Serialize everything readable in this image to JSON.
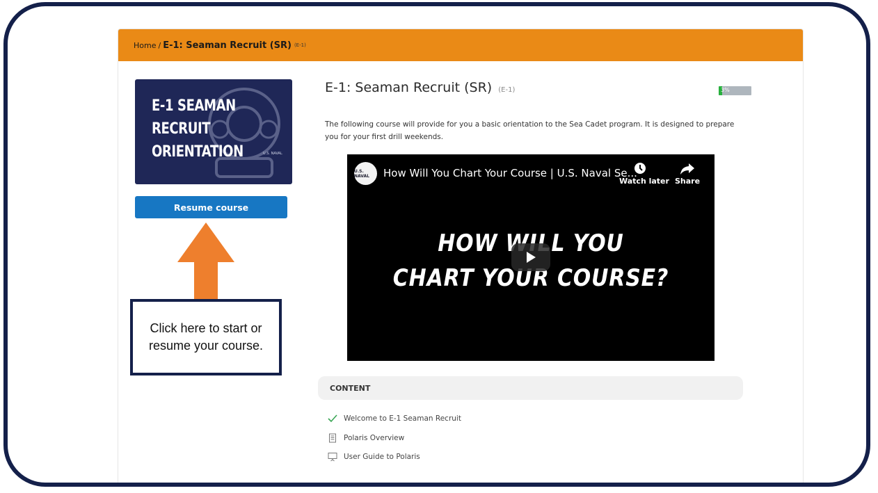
{
  "breadcrumb": {
    "home": "Home",
    "separator": "/",
    "current": "E-1: Seaman Recruit (SR)",
    "code": "(E-1)"
  },
  "course": {
    "thumbnail_text": [
      "E-1 SEAMAN",
      "RECRUIT",
      "ORIENTATION"
    ],
    "thumbnail_logo_text": "U.S. NAVAL",
    "title": "E-1: Seaman Recruit (SR)",
    "code": "(E-1)",
    "progress_label": "3%",
    "progress_fraction": 0.03,
    "description": "The following course will provide for you a basic orientation to the Sea Cadet program. It is designed to prepare you for your first drill weekends.",
    "resume_button": "Resume course"
  },
  "video": {
    "channel_label": "U.S. NAVAL",
    "title": "How Will You Chart Your Course | U.S. Naval Se...",
    "watch_later": "Watch later",
    "share": "Share",
    "headline_line1": "HOW WILL YOU",
    "headline_line2": "CHART YOUR COURSE?"
  },
  "content": {
    "header": "CONTENT",
    "items": [
      {
        "label": "Welcome to E-1 Seaman Recruit",
        "icon": "check-icon"
      },
      {
        "label": "Polaris Overview",
        "icon": "document-icon"
      },
      {
        "label": "User Guide to Polaris",
        "icon": "presentation-icon"
      }
    ]
  },
  "annotation": {
    "callout_text": "Click here to start or resume your course.",
    "arrow_color": "#ee7f2d",
    "frame_color": "#14204a"
  },
  "colors": {
    "breadcrumb_bar": "#ea8a16",
    "button": "#1777c3",
    "progress_fill": "#29b03e",
    "thumbnail_bg": "#1f2757"
  }
}
